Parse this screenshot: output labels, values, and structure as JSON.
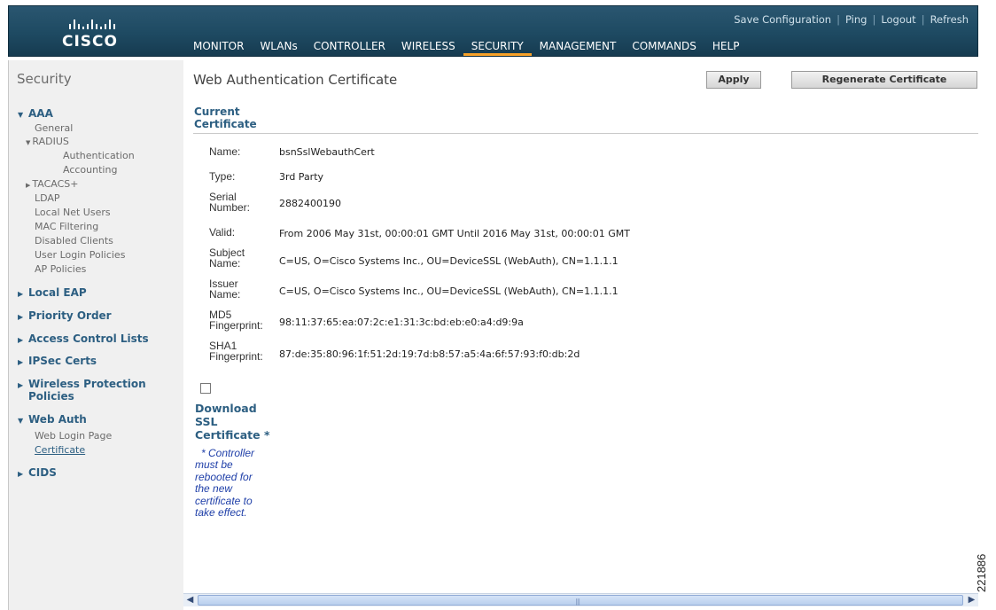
{
  "header": {
    "logo_text": "CISCO",
    "top_links": [
      "Save Configuration",
      "Ping",
      "Logout",
      "Refresh"
    ],
    "nav": [
      {
        "label": "MONITOR",
        "active": false
      },
      {
        "label": "WLANs",
        "active": false
      },
      {
        "label": "CONTROLLER",
        "active": false
      },
      {
        "label": "WIRELESS",
        "active": false
      },
      {
        "label": "SECURITY",
        "active": true
      },
      {
        "label": "MANAGEMENT",
        "active": false
      },
      {
        "label": "COMMANDS",
        "active": false
      },
      {
        "label": "HELP",
        "active": false
      }
    ],
    "colors": {
      "bar": "#1e4a62",
      "active_underline": "#f7a128"
    }
  },
  "sidebar": {
    "title": "Security",
    "aaa": {
      "label": "AAA",
      "items": {
        "general": "General",
        "radius": "RADIUS",
        "authentication": "Authentication",
        "accounting": "Accounting",
        "tacacs": "TACACS+",
        "ldap": "LDAP",
        "local_net_users": "Local Net Users",
        "mac_filtering": "MAC Filtering",
        "disabled_clients": "Disabled Clients",
        "user_login_policies": "User Login Policies",
        "ap_policies": "AP Policies"
      }
    },
    "local_eap": "Local EAP",
    "priority_order": "Priority Order",
    "access_control_lists": "Access Control Lists",
    "ipsec_certs": "IPSec Certs",
    "wireless_protection_policies": [
      "Wireless Protection",
      "Policies"
    ],
    "web_auth": {
      "label": "Web Auth",
      "web_login_page": "Web Login Page",
      "certificate": "Certificate"
    },
    "cids": "CIDS"
  },
  "content": {
    "title": "Web Authentication Certificate",
    "apply_label": "Apply",
    "regenerate_label": "Regenerate Certificate",
    "section_header": [
      "Current",
      "Certificate"
    ],
    "fields": {
      "name": {
        "label": [
          "Name:"
        ],
        "value": "bsnSslWebauthCert"
      },
      "type": {
        "label": [
          "Type:"
        ],
        "value": "3rd Party"
      },
      "serial": {
        "label": [
          "Serial",
          "Number:"
        ],
        "value": "2882400190"
      },
      "valid": {
        "label": [
          "Valid:"
        ],
        "value": "From 2006 May 31st, 00:00:01 GMT  Until 2016 May 31st, 00:00:01 GMT"
      },
      "subject": {
        "label": [
          "Subject",
          "Name:"
        ],
        "value": "C=US, O=Cisco Systems Inc., OU=DeviceSSL (WebAuth), CN=1.1.1.1"
      },
      "issuer": {
        "label": [
          "Issuer",
          "Name:"
        ],
        "value": "C=US, O=Cisco Systems Inc., OU=DeviceSSL (WebAuth), CN=1.1.1.1"
      },
      "md5": {
        "label": [
          "MD5",
          "Fingerprint:"
        ],
        "value": "98:11:37:65:ea:07:2c:e1:31:3c:bd:eb:e0:a4:d9:9a"
      },
      "sha1": {
        "label": [
          "SHA1",
          "Fingerprint:"
        ],
        "value": "87:de:35:80:96:1f:51:2d:19:7d:b8:57:a5:4a:6f:57:93:f0:db:2d"
      }
    },
    "download_checked": false,
    "download_label": [
      "Download",
      "SSL",
      "Certificate *"
    ],
    "note": [
      "* Controller",
      "must be",
      "rebooted for",
      "the new",
      "certificate to",
      "take effect."
    ]
  },
  "figure_id": "221886"
}
